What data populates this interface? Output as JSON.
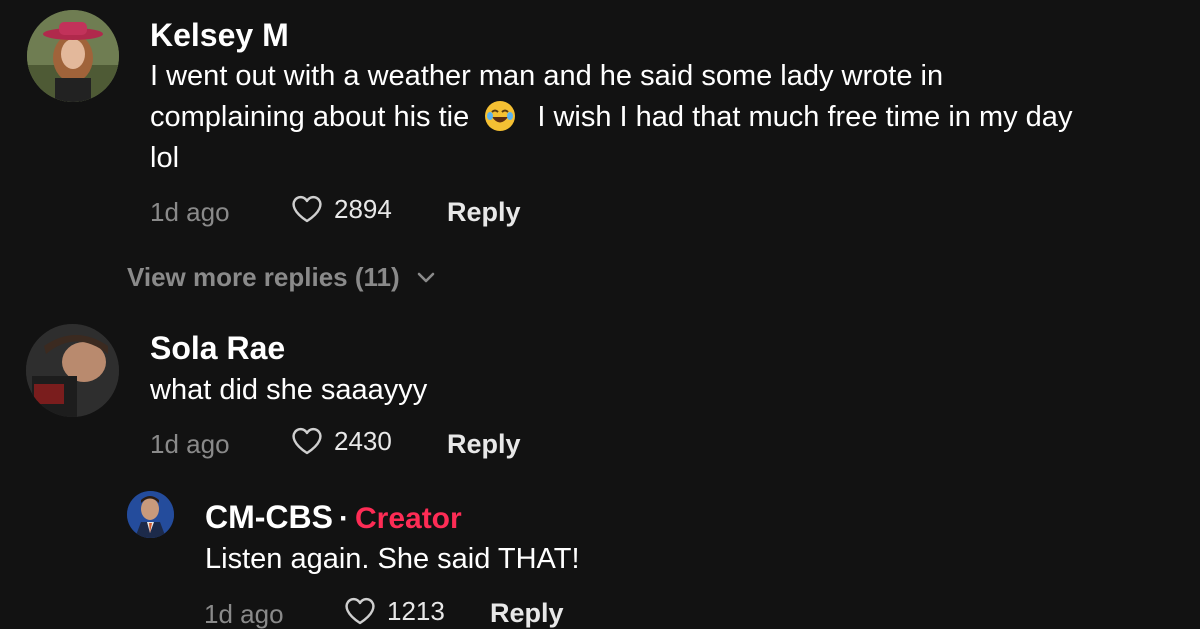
{
  "comments": [
    {
      "username": "Kelsey M",
      "text_line1": "I went out with a weather man and he said some lady wrote in",
      "text_line2a": "complaining about his tie",
      "emoji": "😂",
      "text_line2b": "I wish I had that much free time in my day",
      "text_line3": "lol",
      "time": "1d ago",
      "likes": "2894",
      "reply_label": "Reply",
      "view_more": "View more replies (11)"
    },
    {
      "username": "Sola Rae",
      "text": "what did she saaayyy",
      "time": "1d ago",
      "likes": "2430",
      "reply_label": "Reply"
    }
  ],
  "reply": {
    "username": "CM-CBS",
    "separator": "·",
    "badge": "Creator",
    "text": "Listen again. She said THAT!",
    "time": "1d ago",
    "likes": "1213",
    "reply_label": "Reply"
  },
  "colors": {
    "background": "#121212",
    "creator_badge": "#fe2c55",
    "muted": "#8a8a8a"
  }
}
